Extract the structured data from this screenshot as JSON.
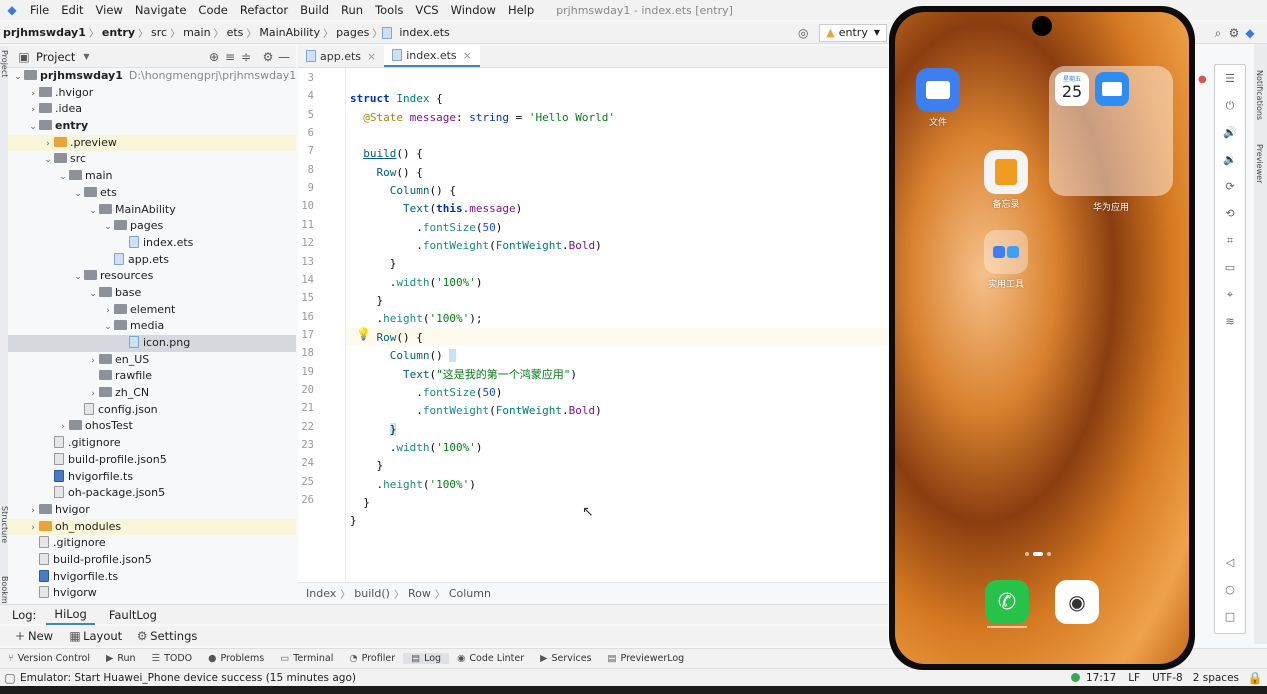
{
  "menu": {
    "items": [
      "File",
      "Edit",
      "View",
      "Navigate",
      "Code",
      "Refactor",
      "Build",
      "Run",
      "Tools",
      "VCS",
      "Window",
      "Help"
    ],
    "window_title": "prjhmswday1 - index.ets [entry]"
  },
  "nav": {
    "breadcrumb": [
      "prjhmswday1",
      "entry",
      "src",
      "main",
      "ets",
      "MainAbility",
      "pages",
      "index.ets"
    ],
    "run_config": "entry"
  },
  "project_panel": {
    "title": "Project",
    "tree": [
      {
        "label": "prjhmswday1",
        "indent": 0,
        "arrow": "v",
        "icon": "folder",
        "bold": true,
        "path": "D:\\hongmengprj\\prjhmswday1"
      },
      {
        "label": ".hvigor",
        "indent": 1,
        "arrow": ">",
        "icon": "folder"
      },
      {
        "label": ".idea",
        "indent": 1,
        "arrow": ">",
        "icon": "folder"
      },
      {
        "label": "entry",
        "indent": 1,
        "arrow": "v",
        "icon": "folder",
        "bold": true
      },
      {
        "label": ".preview",
        "indent": 2,
        "arrow": ">",
        "icon": "folder-o",
        "hl": true
      },
      {
        "label": "src",
        "indent": 2,
        "arrow": "v",
        "icon": "folder"
      },
      {
        "label": "main",
        "indent": 3,
        "arrow": "v",
        "icon": "folder"
      },
      {
        "label": "ets",
        "indent": 4,
        "arrow": "v",
        "icon": "folder"
      },
      {
        "label": "MainAbility",
        "indent": 5,
        "arrow": "v",
        "icon": "folder"
      },
      {
        "label": "pages",
        "indent": 6,
        "arrow": "v",
        "icon": "folder"
      },
      {
        "label": "index.ets",
        "indent": 7,
        "arrow": "",
        "icon": "file"
      },
      {
        "label": "app.ets",
        "indent": 6,
        "arrow": "",
        "icon": "file"
      },
      {
        "label": "resources",
        "indent": 4,
        "arrow": "v",
        "icon": "folder"
      },
      {
        "label": "base",
        "indent": 5,
        "arrow": "v",
        "icon": "folder"
      },
      {
        "label": "element",
        "indent": 6,
        "arrow": ">",
        "icon": "folder"
      },
      {
        "label": "media",
        "indent": 6,
        "arrow": "v",
        "icon": "folder"
      },
      {
        "label": "icon.png",
        "indent": 7,
        "arrow": "",
        "icon": "file",
        "sel": true
      },
      {
        "label": "en_US",
        "indent": 5,
        "arrow": ">",
        "icon": "folder"
      },
      {
        "label": "rawfile",
        "indent": 5,
        "arrow": "",
        "icon": "folder"
      },
      {
        "label": "zh_CN",
        "indent": 5,
        "arrow": ">",
        "icon": "folder"
      },
      {
        "label": "config.json",
        "indent": 4,
        "arrow": "",
        "icon": "file-g"
      },
      {
        "label": "ohosTest",
        "indent": 3,
        "arrow": ">",
        "icon": "folder"
      },
      {
        "label": ".gitignore",
        "indent": 2,
        "arrow": "",
        "icon": "file-g"
      },
      {
        "label": "build-profile.json5",
        "indent": 2,
        "arrow": "",
        "icon": "file-g"
      },
      {
        "label": "hvigorfile.ts",
        "indent": 2,
        "arrow": "",
        "icon": "file-t"
      },
      {
        "label": "oh-package.json5",
        "indent": 2,
        "arrow": "",
        "icon": "file-g"
      },
      {
        "label": "hvigor",
        "indent": 1,
        "arrow": ">",
        "icon": "folder"
      },
      {
        "label": "oh_modules",
        "indent": 1,
        "arrow": ">",
        "icon": "folder-o",
        "hl": true
      },
      {
        "label": ".gitignore",
        "indent": 1,
        "arrow": "",
        "icon": "file-g"
      },
      {
        "label": "build-profile.json5",
        "indent": 1,
        "arrow": "",
        "icon": "file-g"
      },
      {
        "label": "hvigorfile.ts",
        "indent": 1,
        "arrow": "",
        "icon": "file-t"
      },
      {
        "label": "hvigorw",
        "indent": 1,
        "arrow": "",
        "icon": "file-g"
      }
    ]
  },
  "tabs": [
    {
      "label": "app.ets",
      "active": false
    },
    {
      "label": "index.ets",
      "active": true
    }
  ],
  "editor": {
    "line_numbers": [
      "3",
      "4",
      "5",
      "6",
      "7",
      "8",
      "9",
      "10",
      "11",
      "12",
      "13",
      "14",
      "15",
      "16",
      "17",
      "18",
      "19",
      "20",
      "21",
      "22",
      "23",
      "24",
      "25",
      "26"
    ],
    "breadcrumb": [
      "Index",
      "build()",
      "Row",
      "Column"
    ]
  },
  "log": {
    "label": "Log:",
    "tabs": [
      "HiLog",
      "FaultLog"
    ],
    "new": "New",
    "layout": "Layout",
    "settings": "Settings"
  },
  "bottom_tools": [
    "Version Control",
    "Run",
    "TODO",
    "Problems",
    "Terminal",
    "Profiler",
    "Log",
    "Code Linter",
    "Services",
    "PreviewerLog"
  ],
  "status": {
    "message": "Emulator: Start Huawei_Phone device success (15 minutes ago)",
    "position": "17:17",
    "line_sep": "LF",
    "encoding": "UTF-8",
    "indent": "2 spaces"
  },
  "phone": {
    "apps": {
      "files": "文件",
      "memo": "备忘录",
      "tools": "实用工具",
      "huawei_apps": "华为应用",
      "calendar_weekday": "星期五",
      "calendar_day": "25"
    }
  },
  "side_tabs": {
    "notifications": "Notifications",
    "previewer": "Previewer",
    "project": "Project",
    "structure": "Structure",
    "bookmarks": "Bookmarks"
  }
}
